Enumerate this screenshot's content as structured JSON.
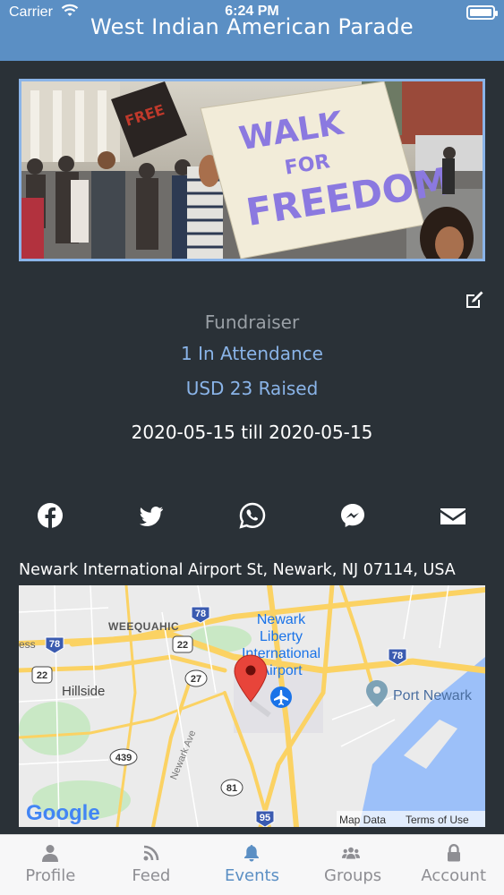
{
  "status_bar": {
    "carrier": "Carrier",
    "time": "6:24 PM"
  },
  "header": {
    "title": "West Indian American Parade"
  },
  "hero": {
    "sign_line1": "WALK",
    "sign_line2": "FOR",
    "sign_line3": "FREEDOM"
  },
  "event": {
    "type": "Fundraiser",
    "attendance": "1 In Attendance",
    "raised": "USD 23 Raised",
    "dates": "2020-05-15 till 2020-05-15"
  },
  "share": {
    "icons": [
      "facebook-icon",
      "twitter-icon",
      "whatsapp-icon",
      "messenger-icon",
      "envelope-icon"
    ]
  },
  "location": {
    "address": "Newark International Airport St, Newark, NJ 07114, USA",
    "map": {
      "labels": {
        "weequahic": "WEEQUAHIC",
        "newark": "Newark",
        "liberty": "Liberty",
        "international": "International",
        "airport": "Airport",
        "hillside": "Hillside",
        "port_newark": "Port Newark",
        "newark_ave": "Newark Ave",
        "ess": "ess"
      },
      "shields": {
        "i78a": "78",
        "i78b": "78",
        "i78c": "78",
        "us22a": "22",
        "us22b": "22",
        "r27": "27",
        "r439": "439",
        "r81": "81",
        "i95": "95"
      },
      "google": "Google",
      "map_data": "Map Data",
      "terms": "Terms of Use"
    }
  },
  "tabs": [
    {
      "label": "Profile",
      "icon": "person-icon",
      "active": false
    },
    {
      "label": "Feed",
      "icon": "rss-icon",
      "active": false
    },
    {
      "label": "Events",
      "icon": "bell-icon",
      "active": true
    },
    {
      "label": "Groups",
      "icon": "users-icon",
      "active": false
    },
    {
      "label": "Account",
      "icon": "lock-icon",
      "active": false
    }
  ],
  "colors": {
    "header": "#5b8fc4",
    "background": "#2a3137",
    "accent": "#8ab4e8",
    "tab_active": "#5b8fc4"
  }
}
